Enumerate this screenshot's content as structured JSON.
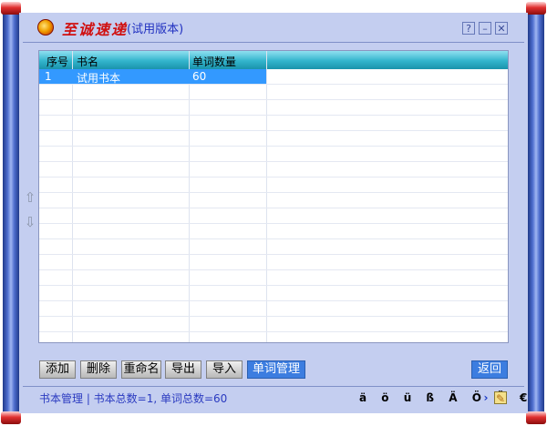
{
  "window": {
    "brand": "至诚速递",
    "subtitle": "(试用版本)",
    "help_label": "?",
    "minimize_label": "–",
    "close_label": "✕"
  },
  "table": {
    "headers": [
      "序号",
      "书名",
      "单词数量"
    ],
    "rows": [
      {
        "index": "1",
        "name": "试用书本",
        "count": "60"
      }
    ]
  },
  "nav": {
    "up_arrow": "⇧",
    "down_arrow": "⇩"
  },
  "toolbar": {
    "add_label": "添加",
    "delete_label": "删除",
    "rename_label": "重命名",
    "export_label": "导出",
    "import_label": "导入",
    "manage_label": "单词管理",
    "back_label": "返回"
  },
  "status": {
    "text": "书本管理 | 书本总数=1, 单词总数=60",
    "special_chars": "ä ö ü ß Ä Ö Ü €",
    "next_icon_glyph": "›",
    "edit_icon_glyph": "✎"
  },
  "colors": {
    "panel": "#c4cef0",
    "header_gradient": "#32b4cc",
    "selection": "#3399ff",
    "accent_button": "#3c7de0",
    "status_text": "#2a3ac0",
    "brand_red": "#d01010"
  },
  "icons": [
    "logo-icon",
    "help-icon",
    "minimize-icon",
    "close-icon",
    "up-arrow-icon",
    "down-arrow-icon",
    "next-icon",
    "edit-icon"
  ]
}
